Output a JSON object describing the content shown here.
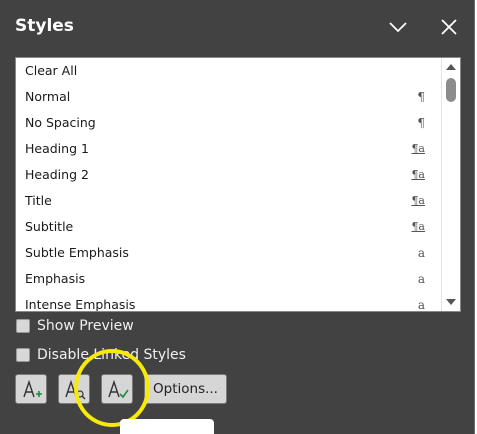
{
  "pane": {
    "title": "Styles",
    "chevron_icon": "chevron-down-icon",
    "close_icon": "close-icon"
  },
  "styles": [
    {
      "name": "Clear All",
      "symbol": ""
    },
    {
      "name": "Normal",
      "symbol": "¶"
    },
    {
      "name": "No Spacing",
      "symbol": "¶"
    },
    {
      "name": "Heading 1",
      "symbol": "¶a"
    },
    {
      "name": "Heading 2",
      "symbol": "¶a"
    },
    {
      "name": "Title",
      "symbol": "¶a"
    },
    {
      "name": "Subtitle",
      "symbol": "¶a"
    },
    {
      "name": "Subtle Emphasis",
      "symbol": "a"
    },
    {
      "name": "Emphasis",
      "symbol": "a"
    },
    {
      "name": "Intense Emphasis",
      "symbol": "a"
    }
  ],
  "options": {
    "show_preview": "Show Preview",
    "disable_linked": "Disable Linked Styles"
  },
  "buttons": {
    "new_style_icon": "new-style-icon",
    "style_inspector_icon": "style-inspector-icon",
    "manage_styles_icon": "manage-styles-icon",
    "options_label": "Options..."
  },
  "colors": {
    "pane_bg": "#424242",
    "highlight_ring": "#f7e90a",
    "new_style_plus": "#1e8a3c",
    "manage_check": "#1e8a3c"
  }
}
